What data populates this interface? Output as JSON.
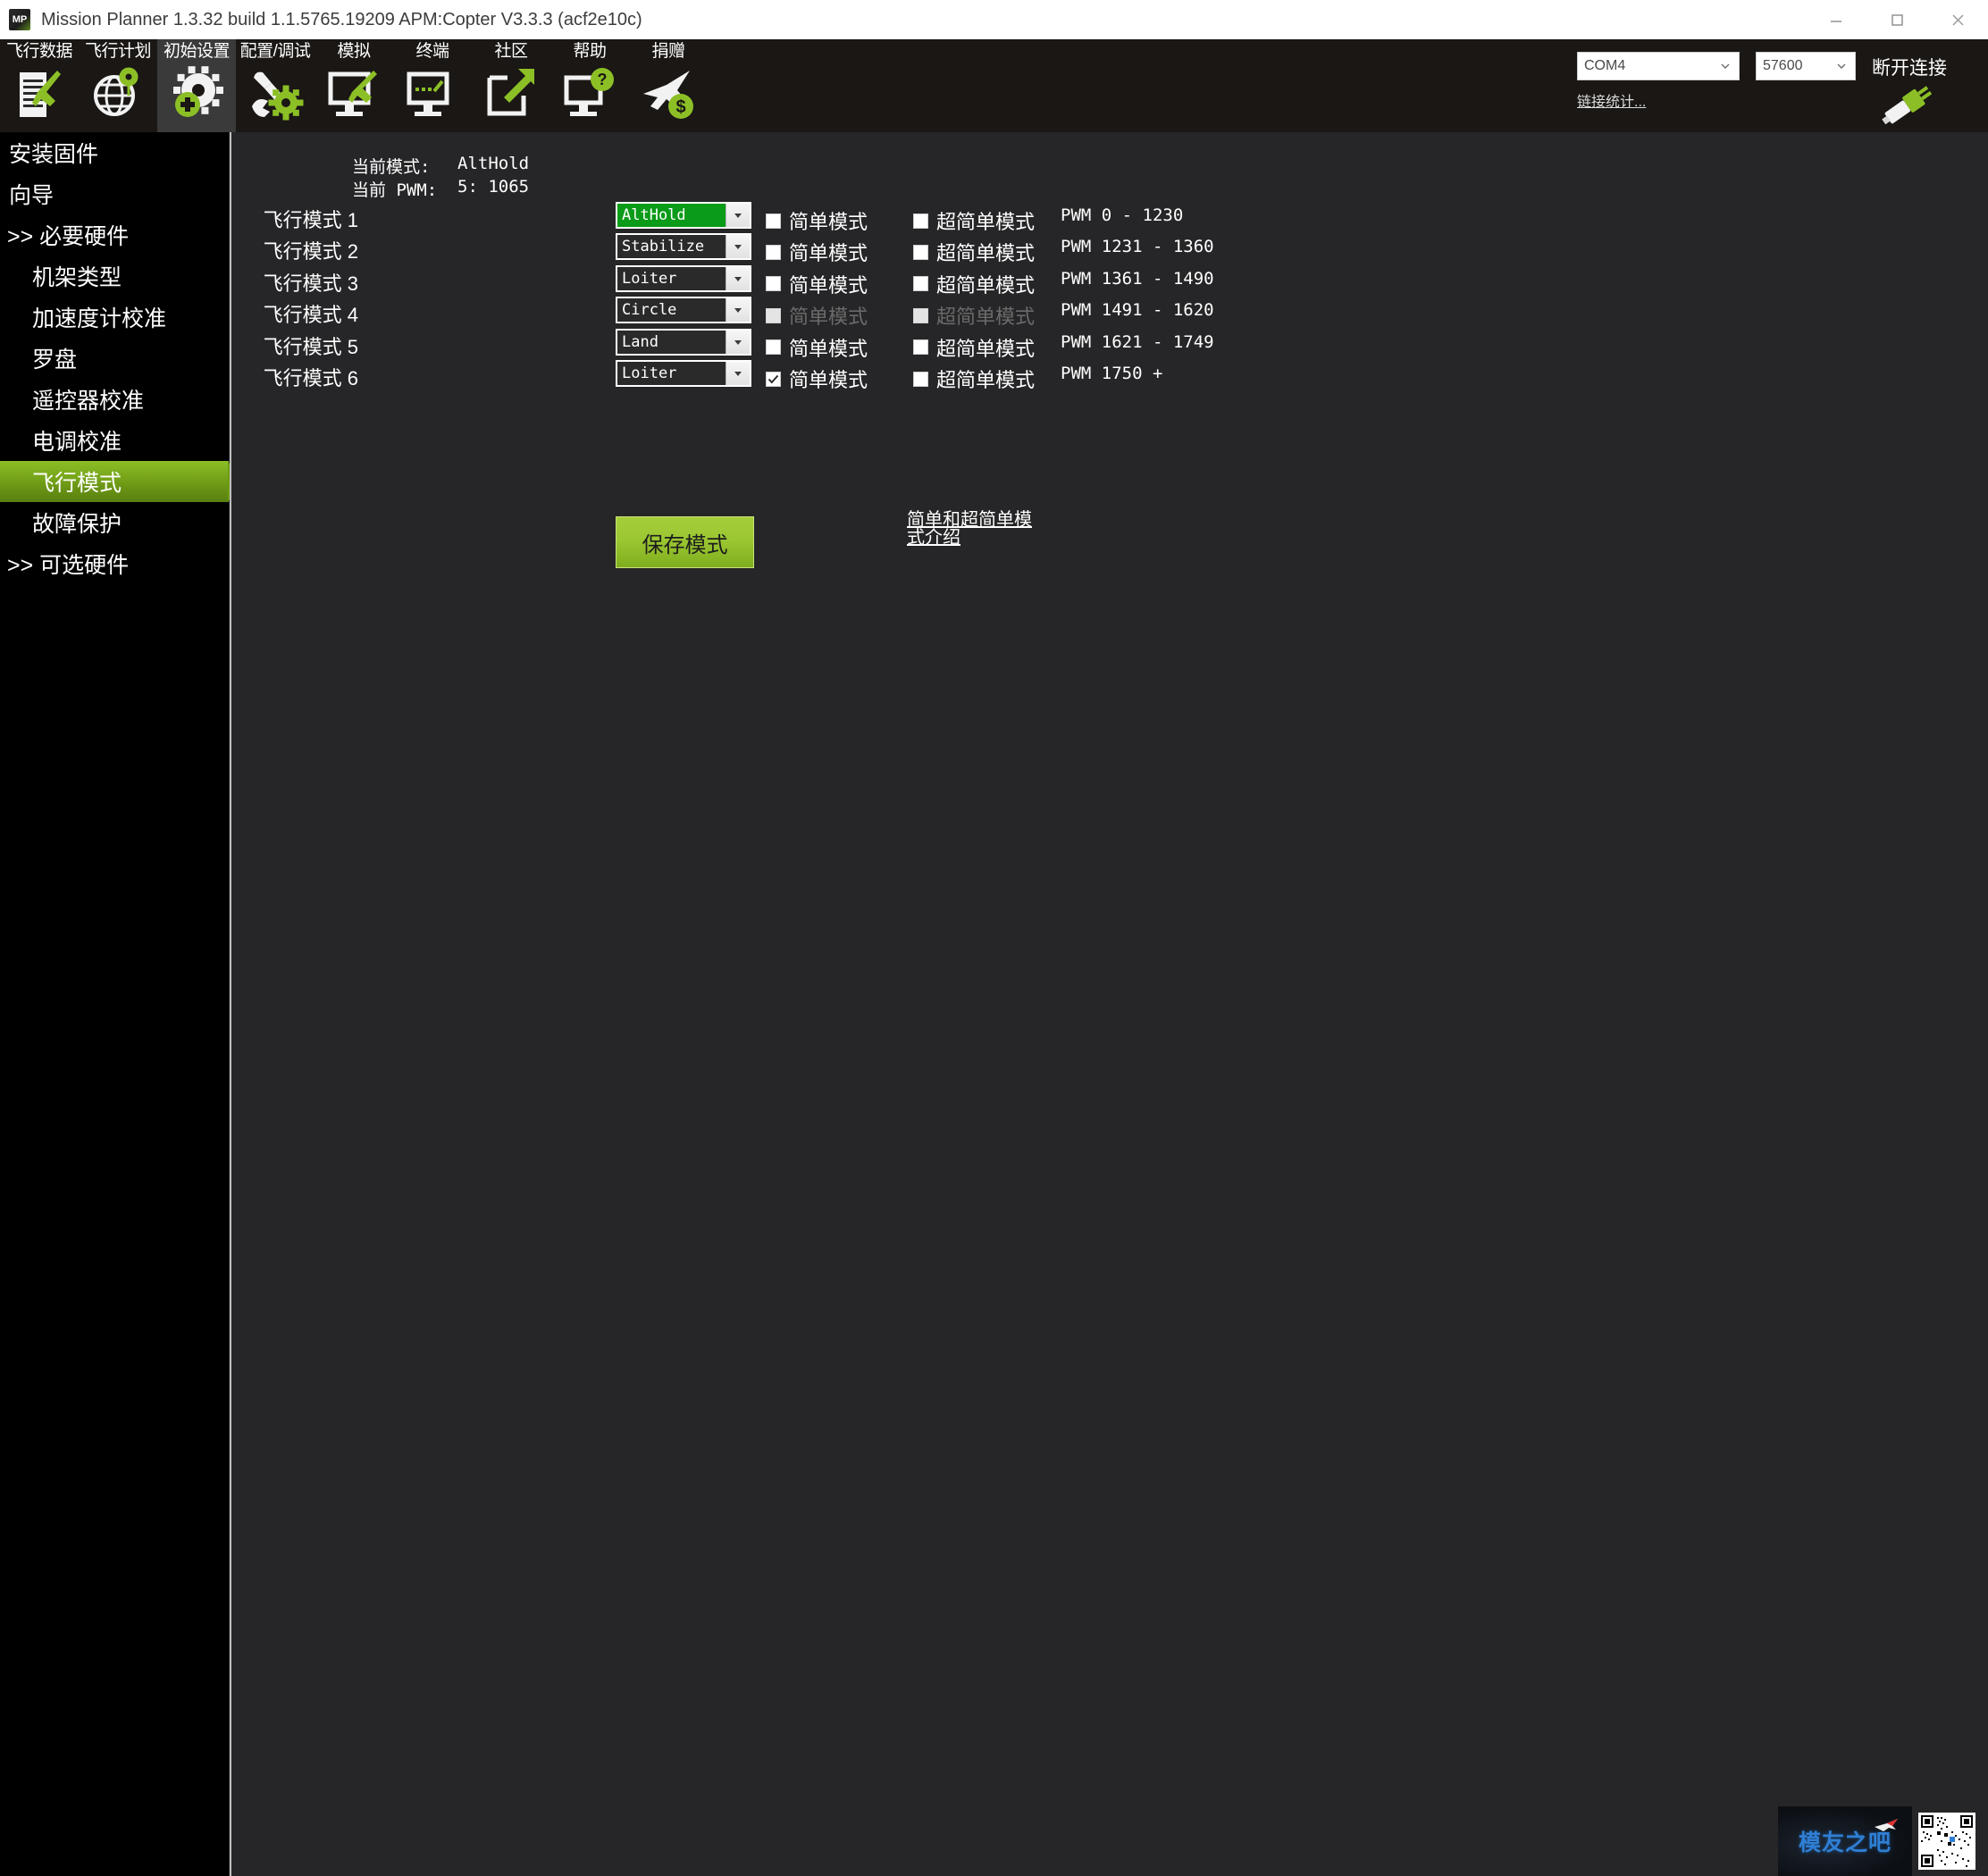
{
  "window": {
    "title": "Mission Planner 1.3.32 build 1.1.5765.19209 APM:Copter V3.3.3 (acf2e10c)",
    "app_icon": "mission-planner-icon",
    "minimize": "minimize-icon",
    "maximize": "maximize-icon",
    "close": "close-icon"
  },
  "toolbar": {
    "tabs": [
      {
        "label": "飞行数据",
        "icon": "flight-data-icon",
        "selected": false
      },
      {
        "label": "飞行计划",
        "icon": "flight-plan-globe-icon",
        "selected": false
      },
      {
        "label": "初始设置",
        "icon": "initial-setup-gear-icon",
        "selected": true
      },
      {
        "label": "配置/调试",
        "icon": "config-tuning-wrench-icon",
        "selected": false
      },
      {
        "label": "模拟",
        "icon": "simulation-monitor-icon",
        "selected": false
      },
      {
        "label": "终端",
        "icon": "terminal-monitor-icon",
        "selected": false
      },
      {
        "label": "社区",
        "icon": "community-share-icon",
        "selected": false
      },
      {
        "label": "帮助",
        "icon": "help-monitor-icon",
        "selected": false
      },
      {
        "label": "捐赠",
        "icon": "donate-plane-icon",
        "selected": false
      }
    ]
  },
  "connection": {
    "port": "COM4",
    "baud": "57600",
    "link_stats": "链接统计...",
    "disconnect": "断开连接",
    "plug_icon": "plug-connected-icon",
    "dropdown_icon": "chevron-down-icon"
  },
  "sidebar": {
    "items": [
      {
        "label": "安装固件",
        "level": 0,
        "selected": false
      },
      {
        "label": "向导",
        "level": 0,
        "selected": false
      },
      {
        "label": ">> 必要硬件",
        "level": 0,
        "selected": false
      },
      {
        "label": "机架类型",
        "level": 1,
        "selected": false
      },
      {
        "label": "加速度计校准",
        "level": 1,
        "selected": false
      },
      {
        "label": "罗盘",
        "level": 1,
        "selected": false
      },
      {
        "label": "遥控器校准",
        "level": 1,
        "selected": false
      },
      {
        "label": "电调校准",
        "level": 1,
        "selected": false
      },
      {
        "label": "飞行模式",
        "level": 1,
        "selected": true
      },
      {
        "label": "故障保护",
        "level": 1,
        "selected": false
      },
      {
        "label": ">> 可选硬件",
        "level": 0,
        "selected": false
      }
    ]
  },
  "main": {
    "current_mode_label": "当前模式:",
    "current_mode_value": "AltHold",
    "current_pwm_label": "当前 PWM:",
    "current_pwm_value": "5: 1065",
    "simple_label": "简单模式",
    "super_simple_label": "超简单模式",
    "save_button": "保存模式",
    "help_link": "简单和超简单模式介绍",
    "rows": [
      {
        "name": "飞行模式 1",
        "mode": "AltHold",
        "highlight": true,
        "simple": false,
        "super_simple": false,
        "enabled": true,
        "pwm": "PWM 0 - 1230"
      },
      {
        "name": "飞行模式 2",
        "mode": "Stabilize",
        "highlight": false,
        "simple": false,
        "super_simple": false,
        "enabled": true,
        "pwm": "PWM 1231 - 1360"
      },
      {
        "name": "飞行模式 3",
        "mode": "Loiter",
        "highlight": false,
        "simple": false,
        "super_simple": false,
        "enabled": true,
        "pwm": "PWM 1361 - 1490"
      },
      {
        "name": "飞行模式 4",
        "mode": "Circle",
        "highlight": false,
        "simple": false,
        "super_simple": false,
        "enabled": false,
        "pwm": "PWM 1491 - 1620"
      },
      {
        "name": "飞行模式 5",
        "mode": "Land",
        "highlight": false,
        "simple": false,
        "super_simple": false,
        "enabled": true,
        "pwm": "PWM 1621 - 1749"
      },
      {
        "name": "飞行模式 6",
        "mode": "Loiter",
        "highlight": false,
        "simple": true,
        "super_simple": false,
        "enabled": true,
        "pwm": "PWM 1750 +"
      }
    ]
  },
  "watermark": {
    "text": "模友之吧",
    "qr": "qr-code-icon",
    "plane": "plane-icon"
  },
  "colors": {
    "accent_green": "#8cbf26",
    "highlight_green": "#0a9b18",
    "toolbar_bg": "#1a1715",
    "content_bg": "#262628",
    "sidebar_bg": "#000000"
  }
}
